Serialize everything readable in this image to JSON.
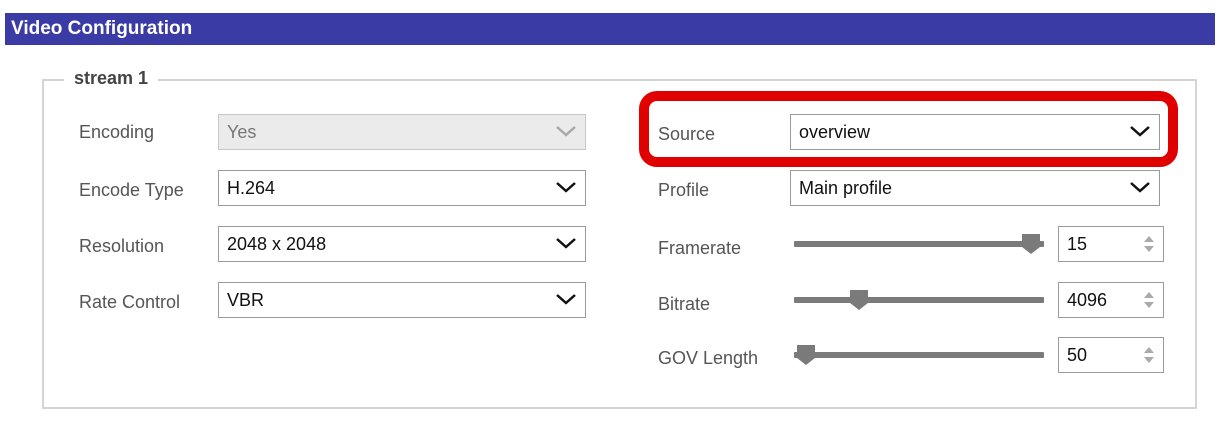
{
  "window": {
    "title": "Video Configuration"
  },
  "stream": {
    "legend": "stream 1"
  },
  "left_fields": [
    {
      "label": "Encoding",
      "value": "Yes",
      "disabled": true
    },
    {
      "label": "Encode Type",
      "value": "H.264",
      "disabled": false
    },
    {
      "label": "Resolution",
      "value": "2048 x 2048",
      "disabled": false
    },
    {
      "label": "Rate Control",
      "value": "VBR",
      "disabled": false
    }
  ],
  "right_selects": [
    {
      "label": "Source",
      "value": "overview",
      "highlighted": true
    },
    {
      "label": "Profile",
      "value": "Main profile",
      "highlighted": false
    }
  ],
  "sliders": [
    {
      "label": "Framerate",
      "value": "15",
      "level": 0.97
    },
    {
      "label": "Bitrate",
      "value": "4096",
      "level": 0.23
    },
    {
      "label": "GOV Length",
      "value": "50",
      "level": 0.0
    }
  ],
  "colors": {
    "titlebar": "#3b3ba6",
    "highlight": "#e00000"
  },
  "icons": {
    "dropdown": "chevron-down-icon",
    "spinner": "spin-arrows-icon",
    "slider": "slider-thumb-icon"
  }
}
